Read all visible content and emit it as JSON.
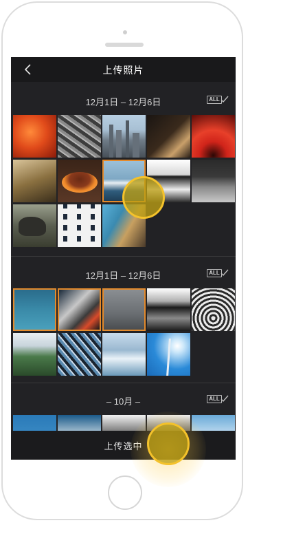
{
  "header": {
    "title": "上传照片",
    "back_icon": "chevron-left-icon"
  },
  "sections": [
    {
      "label": "12月1日 – 12月6日",
      "select_all": "ALL"
    },
    {
      "label": "12月1日 – 12月6日",
      "select_all": "ALL"
    },
    {
      "label": "– 10月 –",
      "select_all": "ALL"
    }
  ],
  "footer": {
    "upload_selected": "上传选中"
  },
  "colors": {
    "selected_border": "#e48a2b",
    "touch_indicator": "#f4c22b",
    "background": "#222225"
  }
}
